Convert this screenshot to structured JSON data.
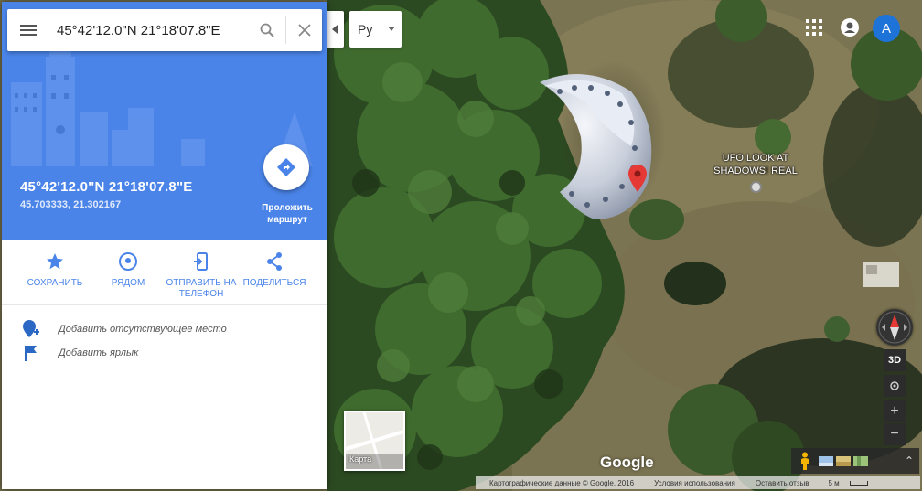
{
  "search": {
    "value": "45°42'12.0\"N 21°18'07.8\"E"
  },
  "place": {
    "title": "45°42'12.0\"N 21°18'07.8\"E",
    "decimal": "45.703333, 21.302167",
    "directions_label": "Проложить маршрут"
  },
  "actions": [
    {
      "label": "Сохранить",
      "icon": "star-icon"
    },
    {
      "label": "Рядом",
      "icon": "nearby-icon"
    },
    {
      "label": "Отправить на телефон",
      "icon": "send-to-phone-icon"
    },
    {
      "label": "Поделиться",
      "icon": "share-icon"
    }
  ],
  "extras": [
    {
      "label": "Добавить отсутствующее место",
      "icon": "add-place-icon"
    },
    {
      "label": "Добавить ярлык",
      "icon": "flag-icon"
    }
  ],
  "language": {
    "value": "Ру"
  },
  "account": {
    "initial": "A"
  },
  "map": {
    "poi_label": "UFO LOOK AT SHADOWS! REAL",
    "toggle_label": "Карта",
    "logo": "Google",
    "btn_3d": "3D"
  },
  "footer": {
    "attribution": "Картографические данные © Google, 2016",
    "terms": "Условия использования",
    "feedback": "Оставить отзыв",
    "scale": "5 м"
  },
  "colors": {
    "accent": "#4a84e8",
    "pin": "#e53935",
    "avatar": "#1d73d8"
  }
}
